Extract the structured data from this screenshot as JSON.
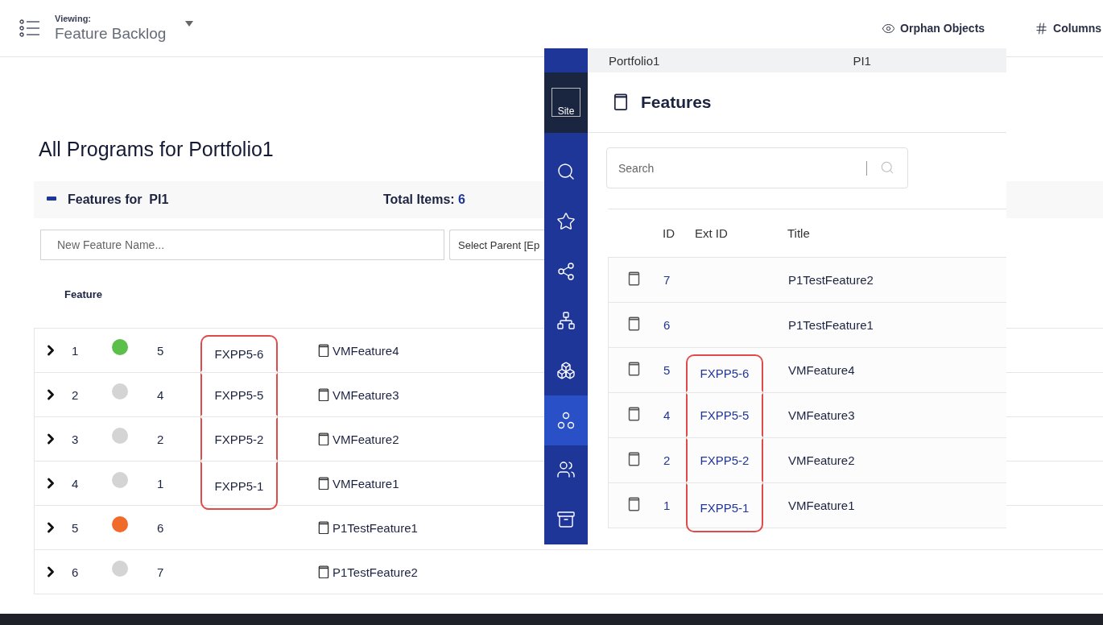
{
  "header": {
    "viewing_label": "Viewing:",
    "view_name": "Feature Backlog",
    "actions": [
      {
        "kind": "eye",
        "label": "Orphan Objects"
      },
      {
        "kind": "grid",
        "label": "Columns"
      }
    ]
  },
  "page_title": "All Programs for Portfolio1",
  "group": {
    "expanded": true,
    "label": "Features for  PI1",
    "total_label": "Total Items:",
    "total": "6"
  },
  "new_feature": {
    "placeholder": "New Feature Name..."
  },
  "parent_select": {
    "value": "Select Parent [Ep"
  },
  "table": {
    "columns": [
      "Feature"
    ],
    "rows": [
      {
        "rank": "1",
        "color": "#5cbf4a",
        "id": "5",
        "ext_id": "FXPP5-6",
        "title": "VMFeature4",
        "highlighted": true
      },
      {
        "rank": "2",
        "color": "#d4d4d4",
        "id": "4",
        "ext_id": "FXPP5-5",
        "title": "VMFeature3",
        "highlighted": true
      },
      {
        "rank": "3",
        "color": "#d4d4d4",
        "id": "2",
        "ext_id": "FXPP5-2",
        "title": "VMFeature2",
        "highlighted": true
      },
      {
        "rank": "4",
        "color": "#d4d4d4",
        "id": "1",
        "ext_id": "FXPP5-1",
        "title": "VMFeature1",
        "highlighted": true
      },
      {
        "rank": "5",
        "color": "#f06a2a",
        "id": "6",
        "title": "P1TestFeature1",
        "highlighted": false
      },
      {
        "rank": "6",
        "color": "#d4d4d4",
        "id": "7",
        "title": "P1TestFeature2",
        "highlighted": false
      }
    ]
  },
  "overlay": {
    "breadcrumb": [
      "Portfolio1",
      "PI1"
    ],
    "site_label": "Site",
    "nav": [
      {
        "kind": "search",
        "selected": false
      },
      {
        "kind": "star",
        "selected": false
      },
      {
        "kind": "network",
        "selected": false
      },
      {
        "kind": "hierarchy",
        "selected": false
      },
      {
        "kind": "blocks",
        "selected": false
      },
      {
        "kind": "circles",
        "selected": true
      },
      {
        "kind": "people",
        "selected": false
      },
      {
        "kind": "archive",
        "selected": false
      }
    ],
    "title": "Features",
    "search": {
      "placeholder": "Search"
    },
    "columns": [
      "ID",
      "Ext ID",
      "Title"
    ],
    "rows": [
      {
        "id": "7",
        "title": "P1TestFeature2",
        "highlighted": false
      },
      {
        "id": "6",
        "title": "P1TestFeature1",
        "highlighted": false
      },
      {
        "id": "5",
        "ext_id": "FXPP5-6",
        "title": "VMFeature4",
        "highlighted": true
      },
      {
        "id": "4",
        "ext_id": "FXPP5-5",
        "title": "VMFeature3",
        "highlighted": true
      },
      {
        "id": "2",
        "ext_id": "FXPP5-2",
        "title": "VMFeature2",
        "highlighted": true
      },
      {
        "id": "1",
        "ext_id": "FXPP5-1",
        "title": "VMFeature1",
        "highlighted": true
      }
    ]
  }
}
